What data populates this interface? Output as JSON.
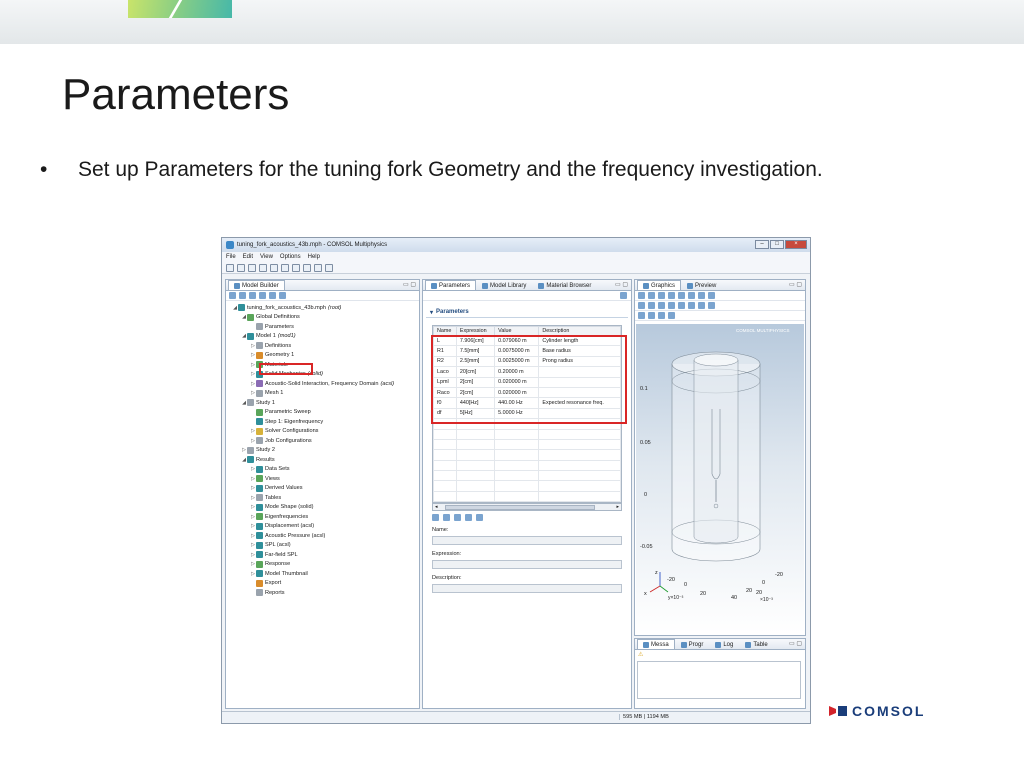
{
  "slide": {
    "title": "Parameters",
    "bullet_symbol": "•",
    "bullet": "Set up Parameters for the tuning fork Geometry and the frequency investigation.",
    "logo_text": "COMSOL"
  },
  "window": {
    "title": "tuning_fork_acoustics_43b.mph - COMSOL Multiphysics",
    "menu": [
      "File",
      "Edit",
      "View",
      "Options",
      "Help"
    ],
    "memory": "595 MB | 1194 MB"
  },
  "model_builder": {
    "tab": "Model Builder",
    "tree": [
      {
        "level": 0,
        "label": "tuning_fork_acoustics_43b.mph",
        "suffix": "(root)",
        "icon": "file-icon",
        "color": "teal",
        "exp": "◢"
      },
      {
        "level": 1,
        "label": "Global Definitions",
        "suffix": "",
        "icon": "globe-icon",
        "color": "green",
        "exp": "◢"
      },
      {
        "level": 2,
        "label": "Parameters",
        "suffix": "",
        "icon": "pi-icon",
        "color": "gray",
        "exp": ""
      },
      {
        "level": 1,
        "label": "Model 1",
        "suffix": "(mod1)",
        "icon": "model-icon",
        "color": "teal",
        "exp": "◢"
      },
      {
        "level": 2,
        "label": "Definitions",
        "suffix": "",
        "icon": "definitions-icon",
        "color": "gray",
        "exp": "▷"
      },
      {
        "level": 2,
        "label": "Geometry 1",
        "suffix": "",
        "icon": "geometry-icon",
        "color": "orange",
        "exp": "▷"
      },
      {
        "level": 2,
        "label": "Materials",
        "suffix": "",
        "icon": "materials-icon",
        "color": "green",
        "exp": "▷"
      },
      {
        "level": 2,
        "label": "Solid Mechanics",
        "suffix": "(solid)",
        "icon": "solid-icon",
        "color": "teal",
        "exp": "▷"
      },
      {
        "level": 2,
        "label": "Acoustic-Solid Interaction, Frequency Domain",
        "suffix": "(acsl)",
        "icon": "acoustic-icon",
        "color": "purple",
        "exp": "▷"
      },
      {
        "level": 2,
        "label": "Mesh 1",
        "suffix": "",
        "icon": "mesh-icon",
        "color": "gray",
        "exp": "▷"
      },
      {
        "level": 1,
        "label": "Study 1",
        "suffix": "",
        "icon": "study-icon",
        "color": "gray",
        "exp": "◢"
      },
      {
        "level": 2,
        "label": "Parametric Sweep",
        "suffix": "",
        "icon": "sweep-icon",
        "color": "green",
        "exp": ""
      },
      {
        "level": 2,
        "label": "Step 1: Eigenfrequency",
        "suffix": "",
        "icon": "step-icon",
        "color": "teal",
        "exp": ""
      },
      {
        "level": 2,
        "label": "Solver Configurations",
        "suffix": "",
        "icon": "solver-icon",
        "color": "yellow",
        "exp": "▷"
      },
      {
        "level": 2,
        "label": "Job Configurations",
        "suffix": "",
        "icon": "job-icon",
        "color": "gray",
        "exp": "▷"
      },
      {
        "level": 1,
        "label": "Study 2",
        "suffix": "",
        "icon": "study-icon",
        "color": "gray",
        "exp": "▷"
      },
      {
        "level": 1,
        "label": "Results",
        "suffix": "",
        "icon": "results-icon",
        "color": "teal",
        "exp": "◢"
      },
      {
        "level": 2,
        "label": "Data Sets",
        "suffix": "",
        "icon": "datasets-icon",
        "color": "teal",
        "exp": "▷"
      },
      {
        "level": 2,
        "label": "Views",
        "suffix": "",
        "icon": "views-icon",
        "color": "green",
        "exp": "▷"
      },
      {
        "level": 2,
        "label": "Derived Values",
        "suffix": "",
        "icon": "derived-icon",
        "color": "teal",
        "exp": "▷"
      },
      {
        "level": 2,
        "label": "Tables",
        "suffix": "",
        "icon": "tables-icon",
        "color": "gray",
        "exp": "▷"
      },
      {
        "level": 2,
        "label": "Mode Shape (solid)",
        "suffix": "",
        "icon": "plot-icon",
        "color": "teal",
        "exp": "▷"
      },
      {
        "level": 2,
        "label": "Eigenfrequencies",
        "suffix": "",
        "icon": "plot1d-icon",
        "color": "green",
        "exp": "▷"
      },
      {
        "level": 2,
        "label": "Displacement (acsl)",
        "suffix": "",
        "icon": "plot-icon",
        "color": "teal",
        "exp": "▷"
      },
      {
        "level": 2,
        "label": "Acoustic Pressure (acsl)",
        "suffix": "",
        "icon": "plot-icon",
        "color": "teal",
        "exp": "▷"
      },
      {
        "level": 2,
        "label": "SPL (acsl)",
        "suffix": "",
        "icon": "plot-icon",
        "color": "teal",
        "exp": "▷"
      },
      {
        "level": 2,
        "label": "Far-field SPL",
        "suffix": "",
        "icon": "plot-icon",
        "color": "teal",
        "exp": "▷"
      },
      {
        "level": 2,
        "label": "Response",
        "suffix": "",
        "icon": "plot1d-icon",
        "color": "green",
        "exp": "▷"
      },
      {
        "level": 2,
        "label": "Model Thumbnail",
        "suffix": "",
        "icon": "plot-icon",
        "color": "teal",
        "exp": "▷"
      },
      {
        "level": 2,
        "label": "Export",
        "suffix": "",
        "icon": "export-icon",
        "color": "orange",
        "exp": ""
      },
      {
        "level": 2,
        "label": "Reports",
        "suffix": "",
        "icon": "reports-icon",
        "color": "gray",
        "exp": ""
      }
    ]
  },
  "settings": {
    "tabs": [
      "Parameters",
      "Model Library",
      "Material Browser"
    ],
    "section": "Parameters",
    "columns": [
      "Name",
      "Expression",
      "Value",
      "Description"
    ],
    "rows": [
      [
        "L",
        "7.906[cm]",
        "0.079060 m",
        "Cylinder length"
      ],
      [
        "R1",
        "7.5[mm]",
        "0.0075000 m",
        "Base radius"
      ],
      [
        "R2",
        "2.5[mm]",
        "0.0025000 m",
        "Prong radius"
      ],
      [
        "Laco",
        "20[cm]",
        "0.20000 m",
        ""
      ],
      [
        "Lpml",
        "2[cm]",
        "0.020000 m",
        ""
      ],
      [
        "Raco",
        "2[cm]",
        "0.020000 m",
        ""
      ],
      [
        "f0",
        "440[Hz]",
        "440.00 Hz",
        "Expected resonance freq."
      ],
      [
        "df",
        "5[Hz]",
        "5.0000 Hz",
        ""
      ]
    ],
    "name_label": "Name:",
    "expression_label": "Expression:",
    "description_label": "Description:"
  },
  "graphics": {
    "tabs": [
      "Graphics",
      "Preview"
    ],
    "brand": "COMSOL MULTIPHYSICS",
    "z_ticks": [
      "0.1",
      "0.05",
      "0",
      "-0.05"
    ],
    "x_ticks": [
      "-20",
      "0",
      "20"
    ],
    "y_ticks": [
      "20",
      "40"
    ],
    "right_ticks": [
      "-20",
      "0",
      "20"
    ],
    "exponent_y": "y×10⁻³",
    "exponent_x": "×10⁻³",
    "axes": [
      "z",
      "x",
      "y"
    ]
  },
  "messages": {
    "tabs": [
      "Messa",
      "Progr",
      "Log",
      "Table"
    ]
  }
}
